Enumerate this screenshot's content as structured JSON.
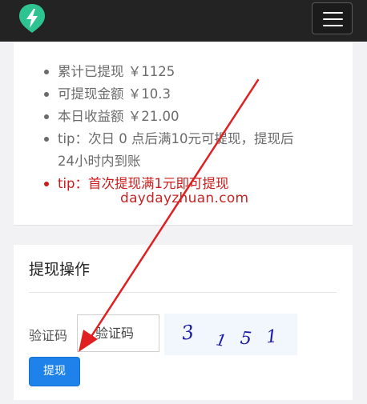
{
  "navbar": {
    "logo_icon": "lightning-bolt-icon",
    "menu_icon": "hamburger-menu-icon",
    "bg_color": "#232323",
    "logo_color": "#2ec492"
  },
  "stats": {
    "total_withdrawn": "累计已提现 ￥1125",
    "withdrawable": "可提现金额 ￥10.3",
    "today_income": "本日收益额 ￥21.00",
    "tip_line1": "tip：次日 0 点后满10元可提现，提现后",
    "tip_line2": "24小时内到账",
    "tip_first": "tip：首次提现满1元即可提现"
  },
  "watermark": "daydayzhuan.com",
  "withdraw": {
    "title": "提现操作",
    "captcha_label": "验证码",
    "captcha_placeholder": "验证码",
    "captcha_chars": [
      "3",
      "1",
      "5",
      "1"
    ],
    "submit_label": "提现",
    "button_color": "#1e82ea"
  },
  "annotation": {
    "arrow_color": "#e02020"
  }
}
